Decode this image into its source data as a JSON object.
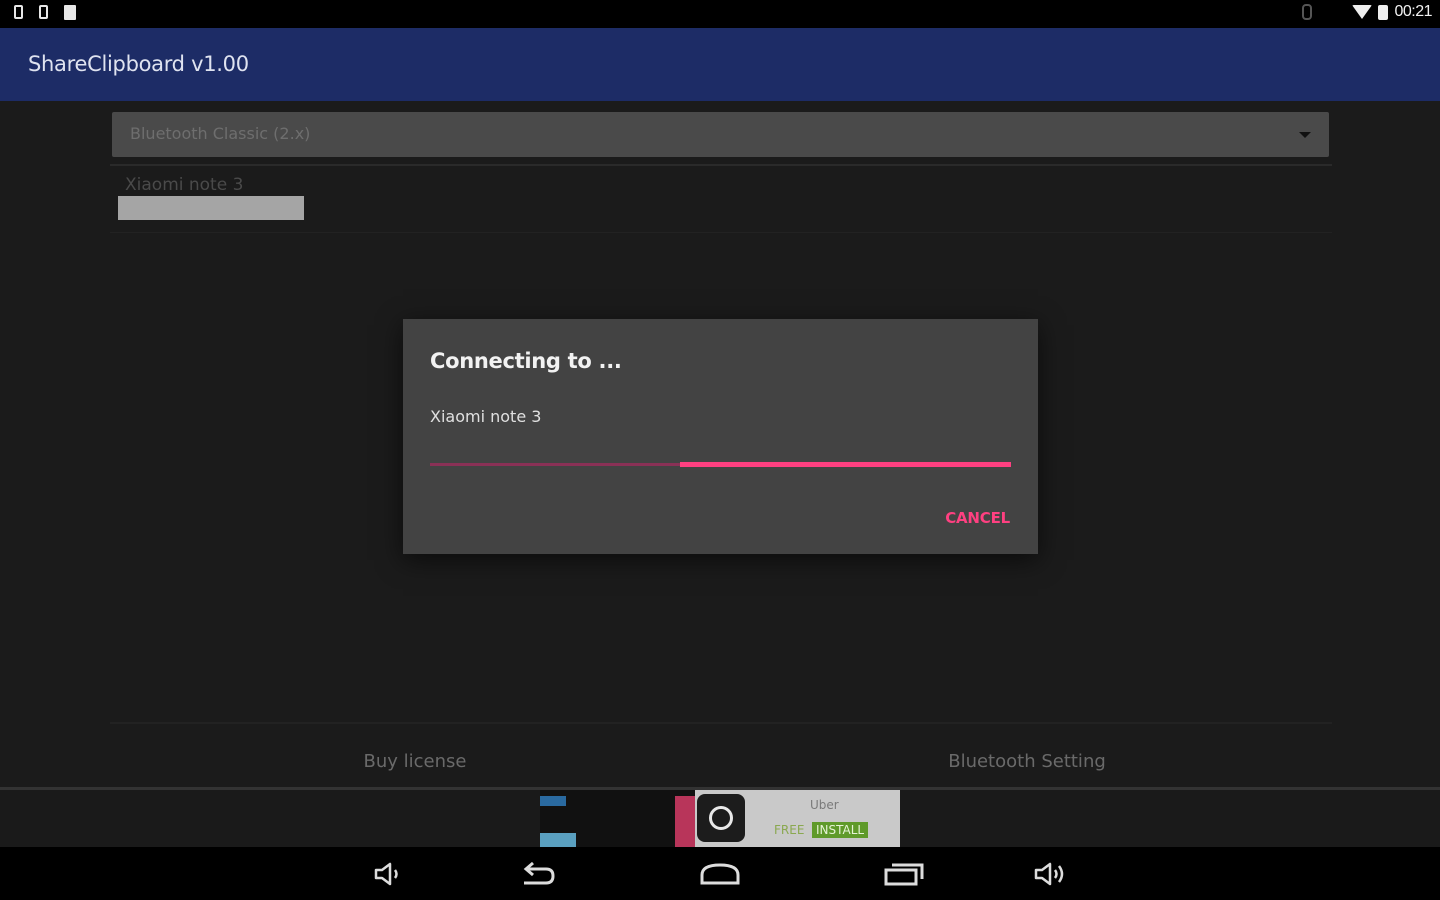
{
  "status_bar": {
    "time": "00:21"
  },
  "app_bar": {
    "title": "ShareClipboard v1.00"
  },
  "spinner": {
    "selected": "Bluetooth Classic (2.x)"
  },
  "devices": [
    {
      "name": "Xiaomi note 3"
    }
  ],
  "dialog": {
    "title": "Connecting to ...",
    "message": "Xiaomi note 3",
    "progress_start": 0.43,
    "progress_end": 1.0,
    "cancel_label": "CANCEL",
    "accent_color": "#ff4081"
  },
  "bottom_buttons": {
    "buy_license": "Buy license",
    "bluetooth_setting": "Bluetooth Setting"
  },
  "ad": {
    "app_name": "Uber",
    "free_label": "FREE",
    "install_label": "INSTALL"
  },
  "colors": {
    "app_bar": "#1d2c66",
    "background": "#1b1b1b",
    "dialog": "#434343"
  }
}
